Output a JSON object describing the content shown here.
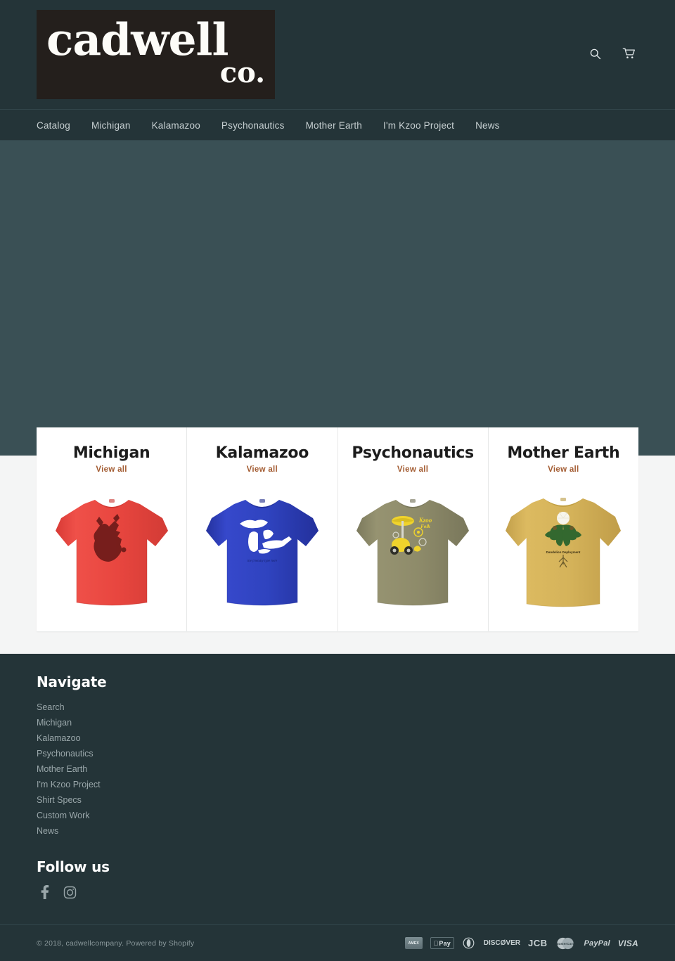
{
  "header": {
    "logo_line1": "cadwell",
    "logo_line2": "co.",
    "search_icon": "search-icon",
    "cart_icon": "cart-icon"
  },
  "nav": {
    "items": [
      {
        "label": "Catalog"
      },
      {
        "label": "Michigan"
      },
      {
        "label": "Kalamazoo"
      },
      {
        "label": "Psychonautics"
      },
      {
        "label": "Mother Earth"
      },
      {
        "label": "I'm Kzoo Project"
      },
      {
        "label": "News"
      }
    ]
  },
  "hero": {
    "background_color": "#3a5055"
  },
  "collections": {
    "view_all_label": "View all",
    "view_all_color": "#a35c32",
    "items": [
      {
        "title": "Michigan",
        "view_all": "View all",
        "shirt_color": "#e8463f",
        "shirt_shadow": "#c93a34",
        "art": "michigan-heart"
      },
      {
        "title": "Kalamazoo",
        "view_all": "View all",
        "shirt_color": "#2f43bf",
        "shirt_shadow": "#26359c",
        "art": "great-lakes"
      },
      {
        "title": "Psychonautics",
        "view_all": "View all",
        "shirt_color": "#8e8b6a",
        "shirt_shadow": "#75735a",
        "art": "kzoo-scooter-mushroom"
      },
      {
        "title": "Mother Earth",
        "view_all": "View all",
        "shirt_color": "#d9b košt",
        "shirt_color_hex": "#d5b35a",
        "shirt_shadow": "#bb9744",
        "art": "dandelion"
      }
    ]
  },
  "footer": {
    "navigate_heading": "Navigate",
    "navigate_links": [
      {
        "label": "Search"
      },
      {
        "label": "Michigan"
      },
      {
        "label": "Kalamazoo"
      },
      {
        "label": "Psychonautics"
      },
      {
        "label": "Mother Earth"
      },
      {
        "label": "I'm Kzoo Project"
      },
      {
        "label": "Shirt Specs"
      },
      {
        "label": "Custom Work"
      },
      {
        "label": "News"
      }
    ],
    "follow_heading": "Follow us",
    "social": [
      {
        "name": "facebook-icon"
      },
      {
        "name": "instagram-icon"
      }
    ],
    "copyright": "© 2018, cadwellcompany. Powered by Shopify",
    "payments": [
      {
        "label": "AMERICAN EXPRESS",
        "key": "amex"
      },
      {
        "label": "Pay",
        "key": "apple"
      },
      {
        "label": "",
        "key": "diners"
      },
      {
        "label": "DISCØVER",
        "key": "discover"
      },
      {
        "label": "JCB",
        "key": "jcb"
      },
      {
        "label": "",
        "key": "mastercard"
      },
      {
        "label": "PayPal",
        "key": "paypal"
      },
      {
        "label": "VISA",
        "key": "visa"
      }
    ]
  }
}
